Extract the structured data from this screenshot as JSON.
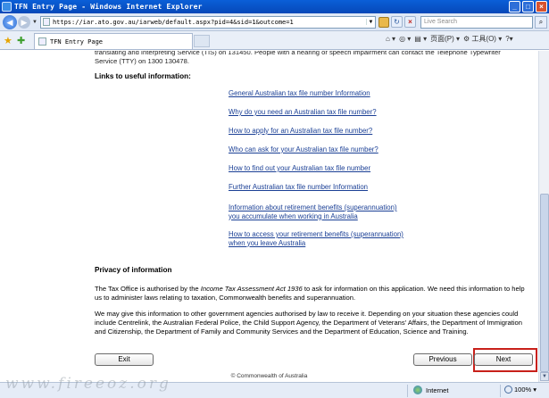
{
  "window": {
    "title": "TFN Entry Page - Windows Internet Explorer"
  },
  "addressbar": {
    "url": "https://iar.ato.gov.au/iarweb/default.aspx?pid=4&sid=1&outcome=1",
    "search_placeholder": "Live Search"
  },
  "tabs": [
    {
      "label": "TFN Entry Page"
    }
  ],
  "command_bar": {
    "page_label": "页面(P)",
    "tools_label": "工具(O)"
  },
  "content": {
    "tty_text": "translating and Interpreting Service (TIS) on 131450. People with a hearing or speech impairment can contact the Telephone Typewriter Service (TTY) on 1300 130478.",
    "links_heading": "Links to useful information:",
    "links": [
      {
        "line1": "General Australian tax file number Information"
      },
      {
        "line1": "Why do you need an Australian tax file number?"
      },
      {
        "line1": "How to apply for an Australian tax file number?"
      },
      {
        "line1": "Who can ask for your Australian tax file number?"
      },
      {
        "line1": "How to find out your Australian tax file number"
      },
      {
        "line1": "Further Australian tax file number Information"
      },
      {
        "line1": "Information about retirement benefits (superannuation)",
        "line2": "you accumulate when working in Australia"
      },
      {
        "line1": "How to access your retirement benefits (superannuation)",
        "line2": "when you leave Australia"
      }
    ],
    "privacy_heading": "Privacy of information",
    "privacy_p1_before": "The Tax Office is authorised by the ",
    "privacy_p1_act": "Income Tax Assessment Act 1936",
    "privacy_p1_after": " to ask for information on this application. We need this information to help us to administer laws relating to taxation, Commonwealth benefits and superannuation.",
    "privacy_p2": "We may give this information to other government agencies authorised by law to receive it. Depending on your situation these agencies could include Centrelink, the Australian Federal Police, the Child Support Agency, the Department of Veterans' Affairs, the Department of Immigration and Citizenship, the Department of Family and Community Services and the Department of Education, Science and Training.",
    "exit_label": "Exit",
    "previous_label": "Previous",
    "next_label": "Next",
    "copyright": "© Commonwealth of Australia"
  },
  "statusbar": {
    "zone": "Internet",
    "zoom": "100%",
    "watermark": "www.fireeoz.org"
  },
  "colors": {
    "link": "#1a3f95",
    "highlight": "#c8201a",
    "titlebar": "#0a5fd8"
  }
}
